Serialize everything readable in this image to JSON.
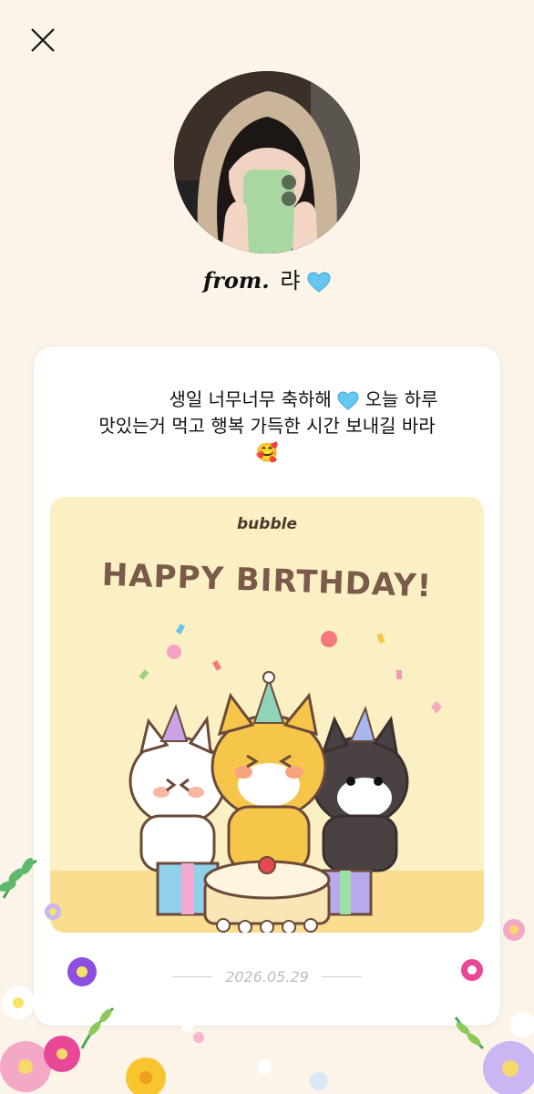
{
  "header": {
    "close_label": "close"
  },
  "sender": {
    "from_label": "from.",
    "name": "랴",
    "name_emoji": "heart-blue"
  },
  "message": {
    "line1": "생일 너무너무 축하해",
    "line1_cont": " 오늘 하루",
    "line2": "맛있는거 먹고 행복 가득한 시간 보내길 바라",
    "emoji": "🥰"
  },
  "banner": {
    "brand": "bubble",
    "title": "HAPPY BIRTHDAY!"
  },
  "card": {
    "date": "2026.05.29"
  },
  "colors": {
    "background": "#fcf4e8",
    "banner_bg": "#fbf0c3",
    "title": "#7a5a4a",
    "heart": "#66c6f0"
  }
}
